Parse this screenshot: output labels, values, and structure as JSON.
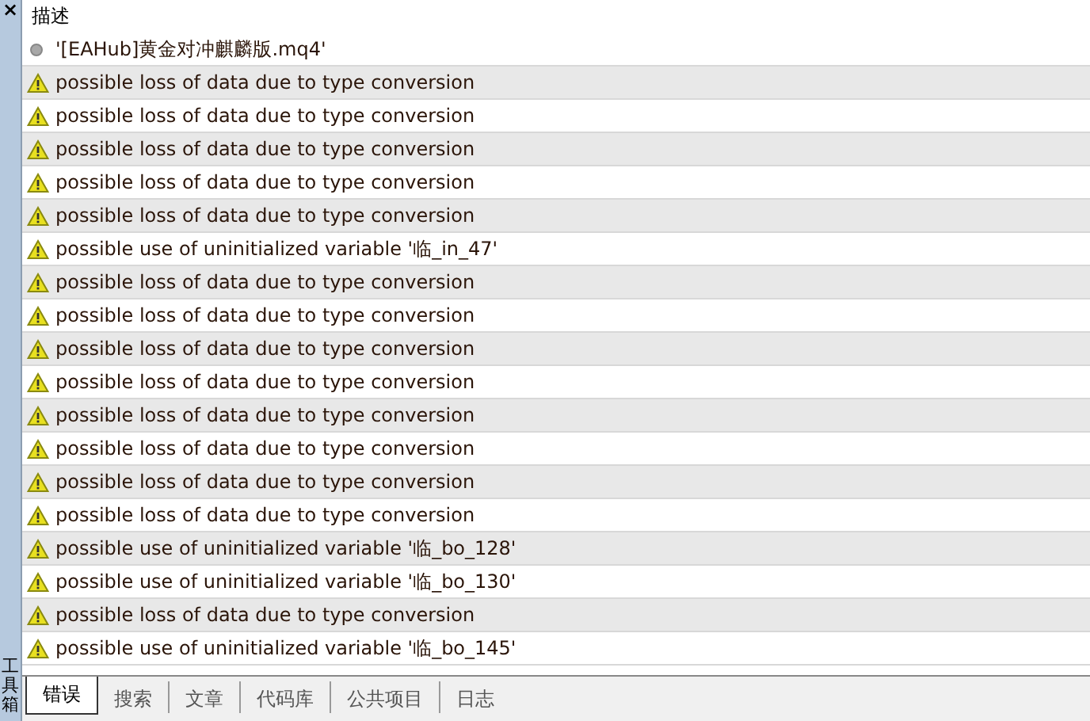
{
  "side_strip": {
    "close": "×",
    "title": "工具箱"
  },
  "header": {
    "column": "描述"
  },
  "rows": [
    {
      "kind": "file",
      "text": "'[EAHub]黄金对冲麒麟版.mq4'"
    },
    {
      "kind": "warning",
      "text": "possible loss of data due to type conversion"
    },
    {
      "kind": "warning",
      "text": "possible loss of data due to type conversion"
    },
    {
      "kind": "warning",
      "text": "possible loss of data due to type conversion"
    },
    {
      "kind": "warning",
      "text": "possible loss of data due to type conversion"
    },
    {
      "kind": "warning",
      "text": "possible loss of data due to type conversion"
    },
    {
      "kind": "warning",
      "text": "possible use of uninitialized variable '临_in_47'"
    },
    {
      "kind": "warning",
      "text": "possible loss of data due to type conversion"
    },
    {
      "kind": "warning",
      "text": "possible loss of data due to type conversion"
    },
    {
      "kind": "warning",
      "text": "possible loss of data due to type conversion"
    },
    {
      "kind": "warning",
      "text": "possible loss of data due to type conversion"
    },
    {
      "kind": "warning",
      "text": "possible loss of data due to type conversion"
    },
    {
      "kind": "warning",
      "text": "possible loss of data due to type conversion"
    },
    {
      "kind": "warning",
      "text": "possible loss of data due to type conversion"
    },
    {
      "kind": "warning",
      "text": "possible loss of data due to type conversion"
    },
    {
      "kind": "warning",
      "text": "possible use of uninitialized variable '临_bo_128'"
    },
    {
      "kind": "warning",
      "text": "possible use of uninitialized variable '临_bo_130'"
    },
    {
      "kind": "warning",
      "text": "possible loss of data due to type conversion"
    },
    {
      "kind": "warning",
      "text": "possible use of uninitialized variable '临_bo_145'"
    }
  ],
  "tabs": [
    {
      "label": "错误",
      "selected": true
    },
    {
      "label": "搜索",
      "selected": false
    },
    {
      "label": "文章",
      "selected": false
    },
    {
      "label": "代码库",
      "selected": false
    },
    {
      "label": "公共项目",
      "selected": false
    },
    {
      "label": "日志",
      "selected": false
    }
  ]
}
